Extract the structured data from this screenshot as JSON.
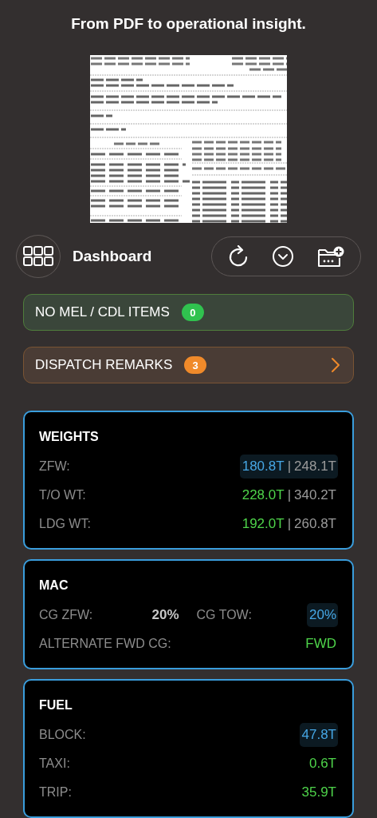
{
  "header": {
    "title": "From PDF to operational insight."
  },
  "toolbar": {
    "title": "Dashboard",
    "actions": [
      {
        "kind": "refresh"
      },
      {
        "kind": "expand"
      },
      {
        "kind": "folder-add"
      }
    ]
  },
  "banners": [
    {
      "label": "NO MEL / CDL ITEMS",
      "count": "0",
      "kind": "status",
      "color": "#30c24f"
    },
    {
      "label": "DISPATCH REMARKS",
      "count": "3",
      "kind": "link",
      "color": "#f08a2a"
    }
  ],
  "cards": [
    {
      "title": "WEIGHTS",
      "rows": [
        {
          "items": [
            {
              "label": "ZFW:",
              "value": "180.8T",
              "separator": "|",
              "limit": "248.1T",
              "color": "#46a6e4",
              "highlighted": true
            }
          ]
        },
        {
          "items": [
            {
              "label": "T/O WT:",
              "value": "228.0T",
              "separator": "|",
              "limit": "340.2T",
              "color": "#4ed34a",
              "highlighted": false
            }
          ]
        },
        {
          "items": [
            {
              "label": "LDG WT:",
              "value": "192.0T",
              "separator": "|",
              "limit": "260.8T",
              "color": "#4ed34a",
              "highlighted": false
            }
          ]
        }
      ]
    },
    {
      "title": "MAC",
      "rows": [
        {
          "items": [
            {
              "label": "CG ZFW:",
              "value": "20%",
              "color": "#c8c8c8",
              "highlighted": false
            },
            {
              "label": "CG TOW:",
              "value": "20%",
              "color": "#46a6e4",
              "highlighted": true
            }
          ]
        },
        {
          "items": [
            {
              "label": "ALTERNATE FWD CG:",
              "value": "FWD",
              "color": "#4ed34a",
              "highlighted": false
            }
          ]
        }
      ]
    },
    {
      "title": "FUEL",
      "rows": [
        {
          "items": [
            {
              "label": "BLOCK:",
              "value": "47.8T",
              "color": "#46a6e4",
              "highlighted": true
            }
          ]
        },
        {
          "items": [
            {
              "label": "TAXI:",
              "value": "0.6T",
              "color": "#4ed34a",
              "highlighted": false
            }
          ]
        },
        {
          "items": [
            {
              "label": "TRIP:",
              "value": "35.9T",
              "color": "#4ed34a",
              "highlighted": false
            }
          ]
        }
      ]
    }
  ]
}
